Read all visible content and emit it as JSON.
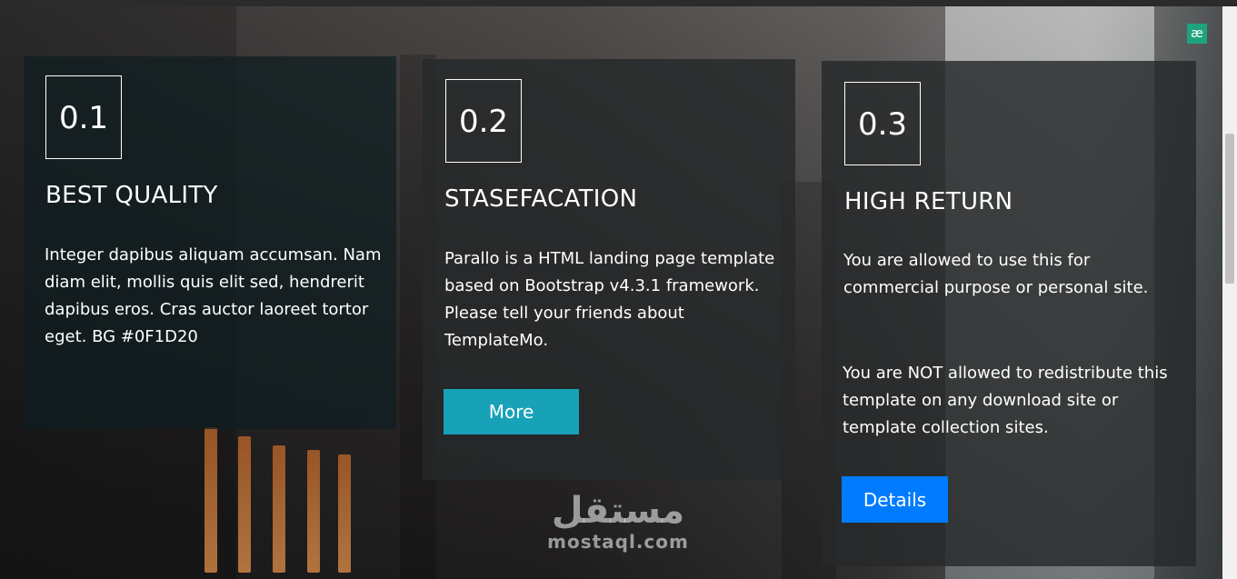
{
  "browser": {
    "extension_icon": "æ"
  },
  "cards": [
    {
      "number": "0.1",
      "title": "BEST QUALITY",
      "text": "Integer dapibus aliquam accumsan. Nam diam elit, mollis quis elit sed, hendrerit dapibus eros. Cras auctor laoreet tortor eget. BG #0F1D20"
    },
    {
      "number": "0.2",
      "title": "STASEFACATION",
      "text": "Parallo is a HTML landing page template based on Bootstrap v4.3.1 framework. Please tell your friends about TemplateMo.",
      "button_label": "More",
      "button_color": "#17a2b8"
    },
    {
      "number": "0.3",
      "title": "HIGH RETURN",
      "text_1": "You are allowed to use this for commercial purpose or personal site.",
      "text_2": "You are NOT allowed to redistribute this template on any download site or template collection sites.",
      "button_label": "Details",
      "button_color": "#007bff"
    }
  ],
  "watermark": {
    "arabic": "مستقل",
    "latin": "mostaql.com"
  },
  "colors": {
    "card_bg": "#0F1D20",
    "text": "#ffffff"
  }
}
